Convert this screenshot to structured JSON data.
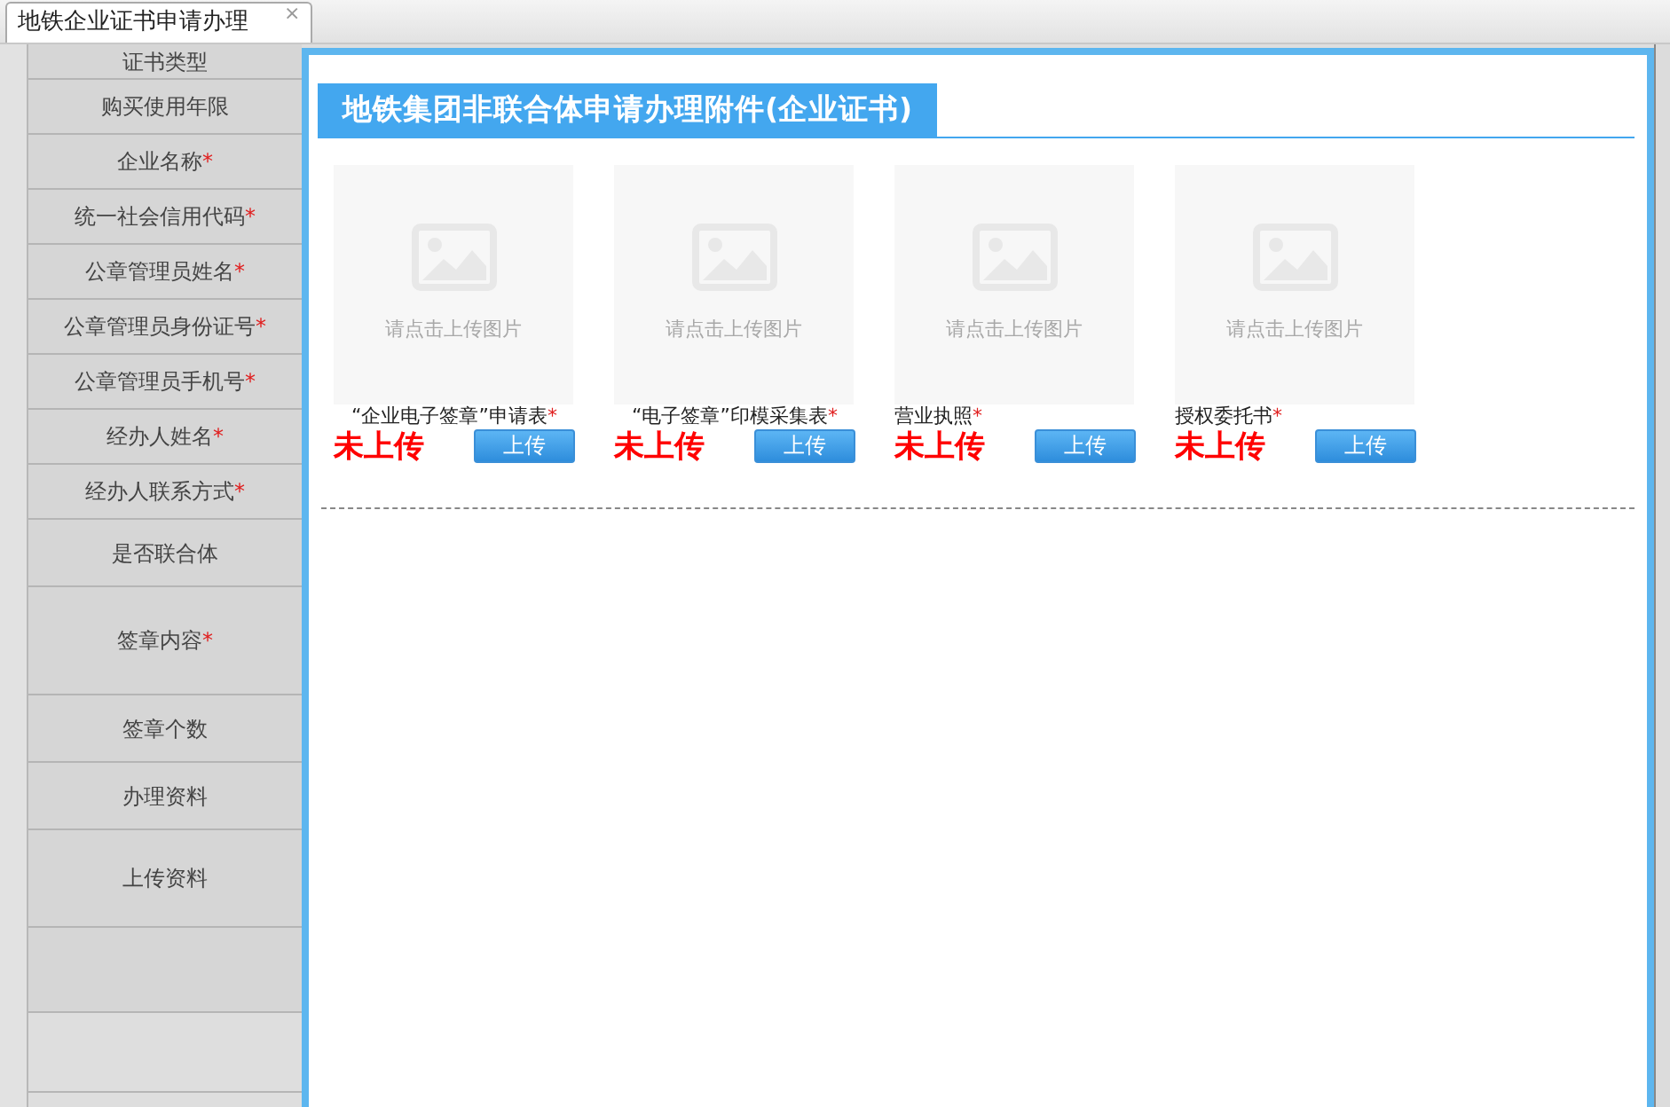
{
  "tabs": [
    {
      "label": "地铁企业证书申请办理",
      "selected": true,
      "close": "×"
    }
  ],
  "form_labels": [
    {
      "label": "证书类型"
    },
    {
      "label": "购买使用年限"
    },
    {
      "label": "企业名称",
      "required_mark": "*"
    },
    {
      "label": "统一社会信用代码",
      "required_mark": "*"
    },
    {
      "label": "公章管理员姓名",
      "required_mark": "*"
    },
    {
      "label": "公章管理员身份证号",
      "required_mark": "*"
    },
    {
      "label": "公章管理员手机号",
      "required_mark": "*"
    },
    {
      "label": "经办人姓名",
      "required_mark": "*"
    },
    {
      "label": "经办人联系方式",
      "required_mark": "*"
    },
    {
      "label": "是否联合体"
    },
    {
      "label": "签章内容",
      "required_mark": "*"
    },
    {
      "label": "签章个数"
    },
    {
      "label": "办理资料"
    },
    {
      "label": "上传资料"
    }
  ],
  "dialog": {
    "title": "地铁集团非联合体申请办理附件(企业证书)",
    "attachments": [
      {
        "placeholder": "请点击上传图片",
        "caption": "“企业电子签章”申请表",
        "required_mark": "*",
        "status": "未上传",
        "button": "上传"
      },
      {
        "placeholder": "请点击上传图片",
        "caption": "“电子签章”印模采集表",
        "required_mark": "*",
        "status": "未上传",
        "button": "上传"
      },
      {
        "placeholder": "请点击上传图片",
        "caption": "营业执照",
        "required_mark": "*",
        "status": "未上传",
        "button": "上传"
      },
      {
        "placeholder": "请点击上传图片",
        "caption": "授权委托书",
        "required_mark": "*",
        "status": "未上传",
        "button": "上传"
      }
    ]
  }
}
